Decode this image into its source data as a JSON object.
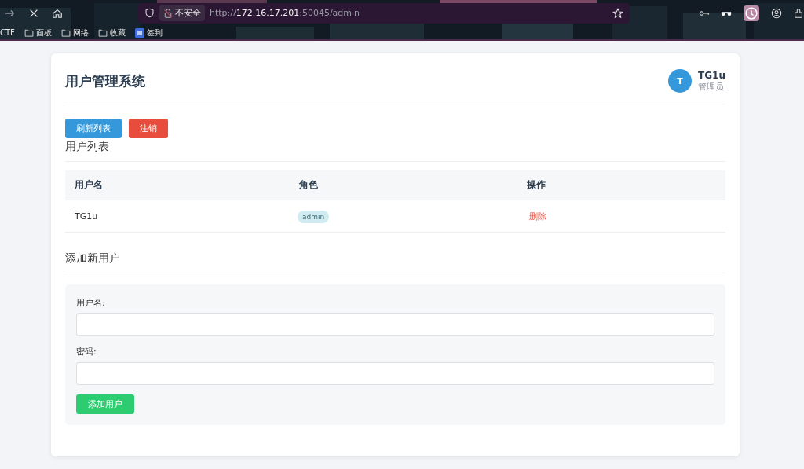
{
  "browser": {
    "security_label": "不安全",
    "url_parts": [
      "http://",
      "172.16.17.201",
      ":50045/admin"
    ],
    "bookmarks": [
      {
        "label": "CTF",
        "kind": "plain"
      },
      {
        "label": "面板",
        "kind": "folder"
      },
      {
        "label": "网络",
        "kind": "folder"
      },
      {
        "label": "收藏",
        "kind": "folder"
      },
      {
        "label": "签到",
        "kind": "app"
      }
    ]
  },
  "header": {
    "title": "用户管理系统",
    "avatar_letter": "T",
    "user_name": "TG1u",
    "user_role": "管理员"
  },
  "actions": [
    {
      "label": "刷新列表",
      "kind": "primary"
    },
    {
      "label": "注销",
      "kind": "danger"
    }
  ],
  "user_list": {
    "title": "用户列表",
    "columns": [
      "用户名",
      "角色",
      "操作"
    ],
    "rows": [
      {
        "username": "TG1u",
        "role": "admin",
        "action": "删除"
      }
    ]
  },
  "add_user": {
    "title": "添加新用户",
    "fields": [
      {
        "label": "用户名:"
      },
      {
        "label": "密码:"
      }
    ],
    "submit": "添加用户"
  }
}
